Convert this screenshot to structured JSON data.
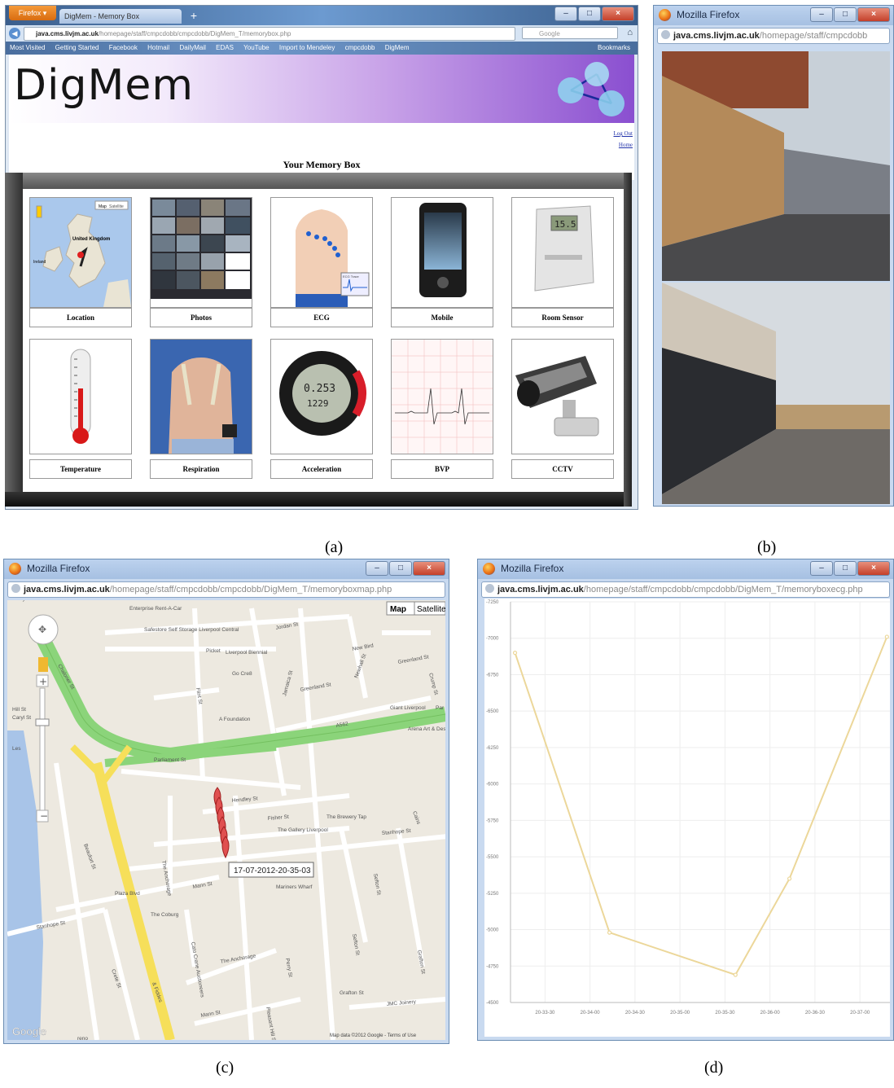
{
  "panel_a": {
    "tab_title": "DigMem - Memory Box",
    "url_host": "java.cms.livjm.ac.uk",
    "url_path": "/homepage/staff/cmpcdobb/cmpcdobb/DigMem_T/memorybox.php",
    "search_placeholder": "Google",
    "bookmarks": [
      "Most Visited",
      "Getting Started",
      "Facebook",
      "Hotmail",
      "DailyMail",
      "EDAS",
      "YouTube",
      "Import to Mendeley",
      "cmpcdobb",
      "DigMem"
    ],
    "bookmarks_right": "Bookmarks",
    "logo_text": "DigMem",
    "top_links": [
      "Log Out",
      "Home"
    ],
    "page_heading": "Your Memory Box",
    "tiles": [
      {
        "label": "Location",
        "icon": "map-icon"
      },
      {
        "label": "Photos",
        "icon": "photos-icon"
      },
      {
        "label": "ECG",
        "icon": "ecg-icon"
      },
      {
        "label": "Mobile",
        "icon": "mobile-icon"
      },
      {
        "label": "Room Sensor",
        "icon": "room-sensor-icon"
      },
      {
        "label": "Temperature",
        "icon": "thermometer-icon"
      },
      {
        "label": "Respiration",
        "icon": "respiration-icon"
      },
      {
        "label": "Acceleration",
        "icon": "watch-icon"
      },
      {
        "label": "BVP",
        "icon": "bvp-icon"
      },
      {
        "label": "CCTV",
        "icon": "cctv-icon"
      }
    ],
    "map_tile_buttons": [
      "Map",
      "Satellite"
    ],
    "map_tile_labels": [
      "United Kingdom",
      "Ireland"
    ],
    "ecg_trace_label": "ECG Trace",
    "sensor_display": "15.5",
    "watch_display": [
      "0.253",
      "1229"
    ]
  },
  "panel_b": {
    "window_title": "Mozilla Firefox",
    "url_host": "java.cms.livjm.ac.uk",
    "url_path": "/homepage/staff/cmpcdobb"
  },
  "panel_c": {
    "window_title": "Mozilla Firefox",
    "url_host": "java.cms.livjm.ac.uk",
    "url_path": "/homepage/staff/cmpcdobb/cmpcdobb/DigMem_T/memoryboxmap.php",
    "map_type_buttons": [
      "Map",
      "Satellite"
    ],
    "tooltip": "17-07-2012-20-35-03",
    "street_labels": [
      "Enterprise Rent-A-Car",
      "Jordan St",
      "Safestore Self Storage Liverpool Central",
      "Picket",
      "Liverpool Biennial",
      "New Bird",
      "Newhall St",
      "Greenland St",
      "Go Cre8",
      "Greenland St",
      "Crump St",
      "Chaloner St",
      "Flint St",
      "A Foundation",
      "Jamaica St",
      "Giant Liverpool",
      "Par",
      "Arena Art & Design",
      "A562",
      "Parliament St",
      "Hendley St",
      "Fisher St",
      "The Gallery Liverpool",
      "The Brewery Tap",
      "Stanhope St",
      "Cains",
      "Beaufort St",
      "The Anchorage",
      "Sefton St",
      "Plaza Blvd",
      "Mann St",
      "The Coburg",
      "Stanhope St",
      "Cato Crane Auctioneers",
      "Mariners Wharf",
      "Crete St",
      "& Fiddes",
      "The Anchorage",
      "Sefton St",
      "Perry St",
      "Grafton St",
      "Grafton St",
      "Mann St",
      "JMC Joinery",
      "Pleasant Hill St",
      "Hill St",
      "Caryl St",
      "Les",
      "reno",
      "e Dolby",
      "Brow"
    ],
    "google_mark": "Google",
    "attribution": "Map data ©2012 Google - Terms of Use"
  },
  "panel_d": {
    "window_title": "Mozilla Firefox",
    "url_host": "java.cms.livjm.ac.uk",
    "url_path": "/homepage/staff/cmpcdobb/cmpcdobb/DigMem_T/memoryboxecg.php"
  },
  "captions": [
    "(a)",
    "(b)",
    "(c)",
    "(d)"
  ],
  "chart_data": {
    "type": "line",
    "x": [
      "20-33-10",
      "20-34-13",
      "20-35-37",
      "20-36-13",
      "20-37-18"
    ],
    "values": [
      6900,
      4980,
      4690,
      5350,
      7010
    ],
    "x_ticks": [
      "20-33-30",
      "20-34-00",
      "20-34-30",
      "20-35-00",
      "20-35-30",
      "20-36-00",
      "20-36-30",
      "20-37-00"
    ],
    "y_ticks": [
      "-7250",
      "-7000",
      "-6750",
      "-6500",
      "-6250",
      "-6000",
      "-5750",
      "-5500",
      "-5250",
      "-5000",
      "-4750",
      "-4500"
    ],
    "ylim": [
      4500,
      7250
    ],
    "grid": true,
    "line_color": "#ecd79a"
  }
}
